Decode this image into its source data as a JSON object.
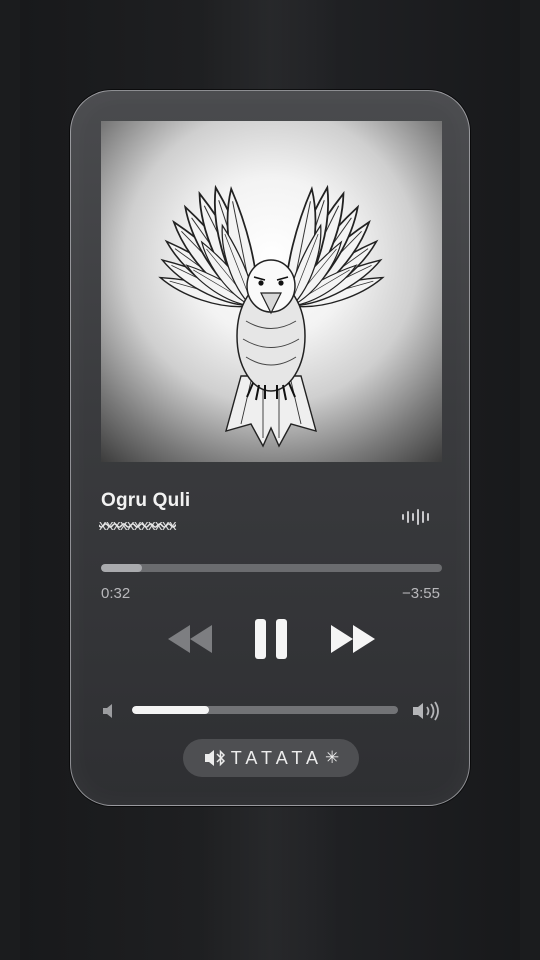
{
  "song": {
    "title": "Ogru Quli",
    "artist": "xxxxxxxxxxx"
  },
  "playback": {
    "elapsed": "0:32",
    "remaining": "−3:55",
    "progress_fraction": 0.12,
    "state": "playing"
  },
  "volume": {
    "level_fraction": 0.29
  },
  "output_device": {
    "name": "TATATA",
    "suffix": "✳",
    "icon": "speaker-bluetooth-icon"
  },
  "icons": {
    "rewind": "rewind-icon",
    "pause": "pause-icon",
    "forward": "fast-forward-icon",
    "volume_low": "volume-low-icon",
    "volume_high": "volume-high-icon",
    "waveform": "waveform-icon"
  },
  "colors": {
    "player_bg": "#3a3b3e",
    "text_primary": "#f2f2f2",
    "text_secondary": "#b8b8bb",
    "progress_track": "#6b6c6f",
    "volume_fill": "#f4f4f4"
  }
}
